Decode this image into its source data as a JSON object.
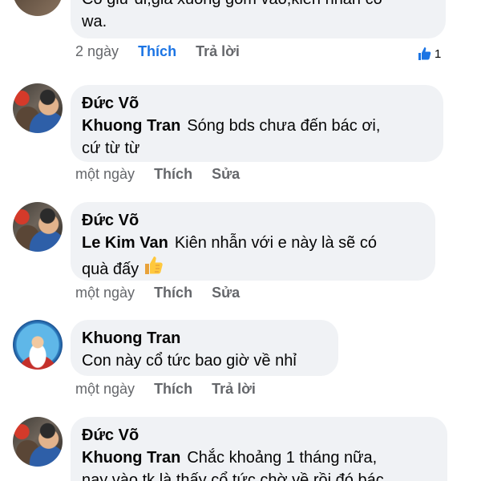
{
  "comments": [
    {
      "text_lines": [
        "Cổ giữ đi,giá xuống gom vào,kiên nhẫn có",
        "wa."
      ],
      "time": "2 ngày",
      "like_label": "Thích",
      "reply_label": "Trả lời",
      "like_count": "1",
      "liked": true
    },
    {
      "author": "Đức Võ",
      "mention": "Khuong Tran",
      "text": "Sóng bds chưa đến bác ơi,",
      "text2": "cứ từ từ",
      "time": "một ngày",
      "like_label": "Thích",
      "edit_label": "Sửa"
    },
    {
      "author": "Đức Võ",
      "mention": "Le Kim Van",
      "text": "Kiên nhẫn với e này là sẽ có",
      "text2": "quà đấy",
      "emoji": "thumbs-up-icon",
      "time": "một ngày",
      "like_label": "Thích",
      "edit_label": "Sửa"
    },
    {
      "author": "Khuong Tran",
      "text": "Con này cổ tức bao giờ về nhỉ",
      "time": "một ngày",
      "like_label": "Thích",
      "reply_label": "Trả lời"
    },
    {
      "author": "Đức Võ",
      "mention": "Khuong Tran",
      "text": "Chắc khoảng 1 tháng nữa,",
      "text2": "nay vào tk là thấy cổ tức chờ về rồi đó bác"
    }
  ],
  "colors": {
    "bubble": "#f0f2f5",
    "meta": "#65676b",
    "liked": "#1b74e4",
    "text": "#050505"
  }
}
